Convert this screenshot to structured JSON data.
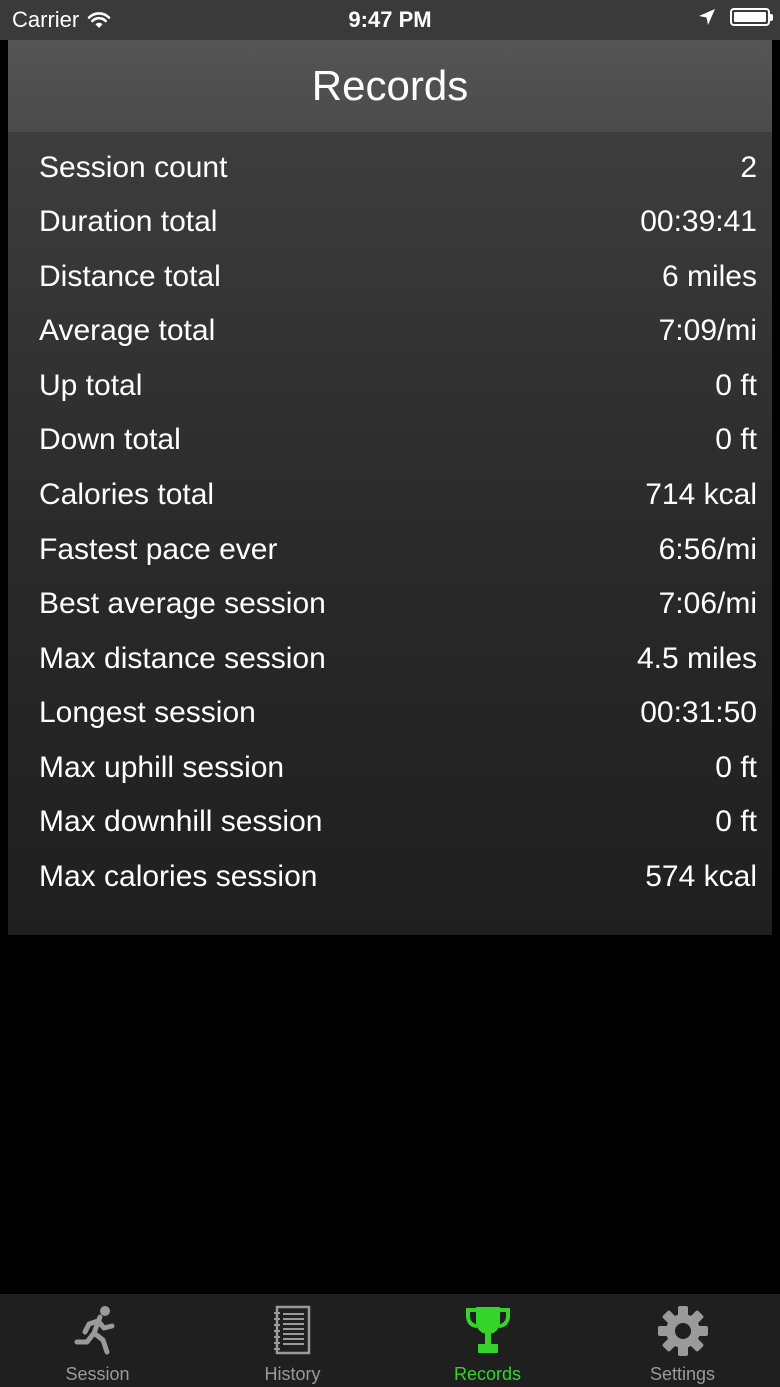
{
  "status_bar": {
    "carrier": "Carrier",
    "time": "9:47 PM"
  },
  "header": {
    "title": "Records"
  },
  "records": [
    {
      "label": "Session count",
      "value": "2"
    },
    {
      "label": "Duration total",
      "value": "00:39:41"
    },
    {
      "label": "Distance total",
      "value": "6 miles"
    },
    {
      "label": "Average total",
      "value": "7:09/mi"
    },
    {
      "label": "Up total",
      "value": "0 ft"
    },
    {
      "label": "Down total",
      "value": "0 ft"
    },
    {
      "label": "Calories total",
      "value": "714 kcal"
    },
    {
      "label": "Fastest pace ever",
      "value": "6:56/mi"
    },
    {
      "label": "Best average session",
      "value": "7:06/mi"
    },
    {
      "label": "Max distance session",
      "value": "4.5 miles"
    },
    {
      "label": "Longest session",
      "value": "00:31:50"
    },
    {
      "label": "Max uphill session",
      "value": "0 ft"
    },
    {
      "label": "Max downhill session",
      "value": "0 ft"
    },
    {
      "label": "Max calories session",
      "value": "574 kcal"
    }
  ],
  "tab_bar": {
    "active": "Records",
    "active_color": "#35d42a",
    "tabs": [
      {
        "label": "Session",
        "icon": "runner-icon"
      },
      {
        "label": "History",
        "icon": "notebook-icon"
      },
      {
        "label": "Records",
        "icon": "trophy-icon"
      },
      {
        "label": "Settings",
        "icon": "gear-icon"
      }
    ]
  }
}
